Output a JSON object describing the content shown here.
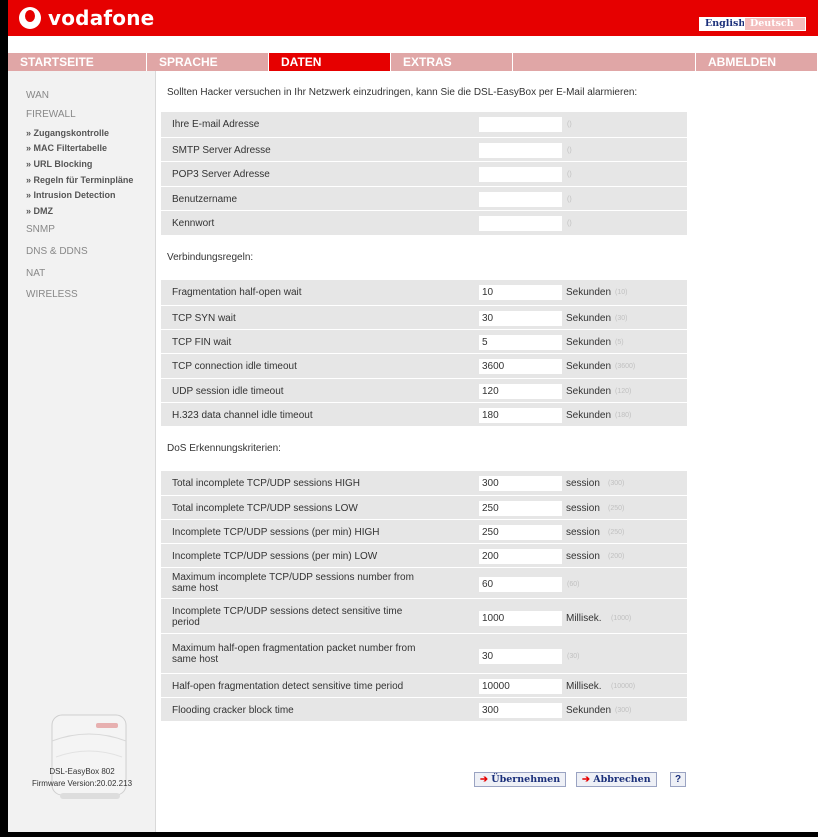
{
  "header": {
    "brand": "vodafone",
    "lang_english": "English",
    "lang_deutsch": "Deutsch"
  },
  "nav": [
    "STARTSEITE",
    "SPRACHE",
    "DATEN",
    "EXTRAS",
    "ABMELDEN"
  ],
  "sidebar": {
    "wan": "WAN",
    "firewall": "FIREWALL",
    "subitems": [
      "» Zugangskontrolle",
      "» MAC Filtertabelle",
      "» URL Blocking",
      "» Regeln für Terminpläne",
      "» Intrusion Detection",
      "» DMZ"
    ],
    "snmp": "SNMP",
    "dns": "DNS & DDNS",
    "nat": "NAT",
    "wireless": "WIRELESS",
    "device_name": "DSL-EasyBox 802",
    "firmware": "Firmware Version:20.02.213"
  },
  "intro": "Sollten Hacker versuchen in Ihr Netzwerk einzudringen, kann Sie die DSL-EasyBox per E-Mail alarmieren:",
  "email": [
    {
      "label": "Ihre E-mail Adresse",
      "value": "",
      "default": "()"
    },
    {
      "label": "SMTP Server Adresse",
      "value": "",
      "default": "()"
    },
    {
      "label": "POP3 Server Adresse",
      "value": "",
      "default": "()"
    },
    {
      "label": "Benutzername",
      "value": "",
      "default": "()"
    },
    {
      "label": "Kennwort",
      "value": "",
      "default": "()"
    }
  ],
  "conn_title": "Verbindungsregeln:",
  "conn": [
    {
      "label": "Fragmentation half-open wait",
      "value": "10",
      "unit": "Sekunden",
      "default": "(10)"
    },
    {
      "label": "TCP SYN wait",
      "value": "30",
      "unit": "Sekunden",
      "default": "(30)"
    },
    {
      "label": "TCP FIN wait",
      "value": "5",
      "unit": "Sekunden",
      "default": "(5)"
    },
    {
      "label": "TCP connection idle timeout",
      "value": "3600",
      "unit": "Sekunden",
      "default": "(3600)"
    },
    {
      "label": "UDP session idle timeout",
      "value": "120",
      "unit": "Sekunden",
      "default": "(120)"
    },
    {
      "label": "H.323 data channel idle timeout",
      "value": "180",
      "unit": "Sekunden",
      "default": "(180)"
    }
  ],
  "dos_title": "DoS Erkennungskriterien:",
  "dos": [
    {
      "label": "Total incomplete TCP/UDP sessions HIGH",
      "value": "300",
      "unit": "session",
      "default": "(300)"
    },
    {
      "label": "Total incomplete TCP/UDP sessions LOW",
      "value": "250",
      "unit": "session",
      "default": "(250)"
    },
    {
      "label": "Incomplete TCP/UDP sessions (per min) HIGH",
      "value": "250",
      "unit": "session",
      "default": "(250)"
    },
    {
      "label": "Incomplete TCP/UDP sessions (per min) LOW",
      "value": "200",
      "unit": "session",
      "default": "(200)"
    },
    {
      "label": "Maximum incomplete TCP/UDP sessions number from same host",
      "value": "60",
      "unit": "",
      "default": "(60)"
    },
    {
      "label": "Incomplete TCP/UDP sessions detect sensitive time period",
      "value": "1000",
      "unit": "Millisek.",
      "default": "(1000)"
    },
    {
      "label": "Maximum half-open fragmentation packet number from same host",
      "value": "30",
      "unit": "",
      "default": "(30)"
    },
    {
      "label": "Half-open fragmentation detect sensitive time period",
      "value": "10000",
      "unit": "Millisek.",
      "default": "(10000)"
    },
    {
      "label": "Flooding cracker block time",
      "value": "300",
      "unit": "Sekunden",
      "default": "(300)"
    }
  ],
  "buttons": {
    "apply": "Übernehmen",
    "cancel": "Abbrechen",
    "help": "?",
    "arrow": "➔"
  },
  "colors": {
    "brand_red": "#e60000",
    "nav_inactive": "#e0a6a6",
    "row_bg": "#e6e6e6"
  }
}
